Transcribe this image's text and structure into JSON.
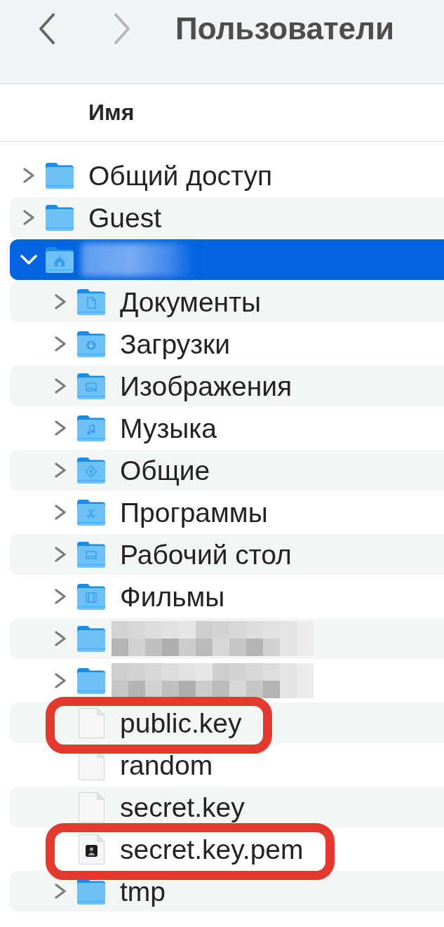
{
  "toolbar": {
    "back": {
      "disabled": false
    },
    "forward": {
      "disabled": true
    },
    "title": "Пользователи"
  },
  "list": {
    "columns": [
      {
        "label": "Имя"
      }
    ],
    "items": [
      {
        "kind": "folder",
        "name": "Общий доступ",
        "expanded": false,
        "selected": false
      },
      {
        "kind": "folder",
        "name": "Guest",
        "expanded": false,
        "selected": false
      },
      {
        "kind": "home",
        "redacted": true,
        "expanded": true,
        "selected": true,
        "children": [
          {
            "kind": "documents",
            "name": "Документы",
            "expanded": false,
            "selected": false,
            "highlighted": false
          },
          {
            "kind": "downloads",
            "name": "Загрузки",
            "expanded": false,
            "selected": false,
            "highlighted": false
          },
          {
            "kind": "pictures",
            "name": "Изображения",
            "expanded": false,
            "selected": false,
            "highlighted": false
          },
          {
            "kind": "music",
            "name": "Музыка",
            "expanded": false,
            "selected": false,
            "highlighted": false
          },
          {
            "kind": "public",
            "name": "Общие",
            "expanded": false,
            "selected": false,
            "highlighted": false
          },
          {
            "kind": "apps",
            "name": "Программы",
            "expanded": false,
            "selected": false,
            "highlighted": false
          },
          {
            "kind": "desktop",
            "name": "Рабочий стол",
            "expanded": false,
            "selected": false,
            "highlighted": false
          },
          {
            "kind": "movies",
            "name": "Фильмы",
            "expanded": false,
            "selected": false,
            "highlighted": false
          },
          {
            "kind": "folder",
            "redacted": true,
            "expanded": false,
            "selected": false,
            "highlighted": false
          },
          {
            "kind": "folder",
            "redacted": true,
            "expanded": false,
            "selected": false,
            "highlighted": false
          },
          {
            "kind": "file",
            "name": "public.key",
            "selected": false,
            "highlighted": true
          },
          {
            "kind": "file",
            "name": "random",
            "selected": false,
            "highlighted": false
          },
          {
            "kind": "file",
            "name": "secret.key",
            "selected": false,
            "highlighted": false
          },
          {
            "kind": "certificate",
            "name": "secret.key.pem",
            "selected": false,
            "highlighted": true
          },
          {
            "kind": "folder",
            "name": "tmp",
            "expanded": false,
            "selected": false,
            "highlighted": false
          }
        ]
      }
    ]
  }
}
